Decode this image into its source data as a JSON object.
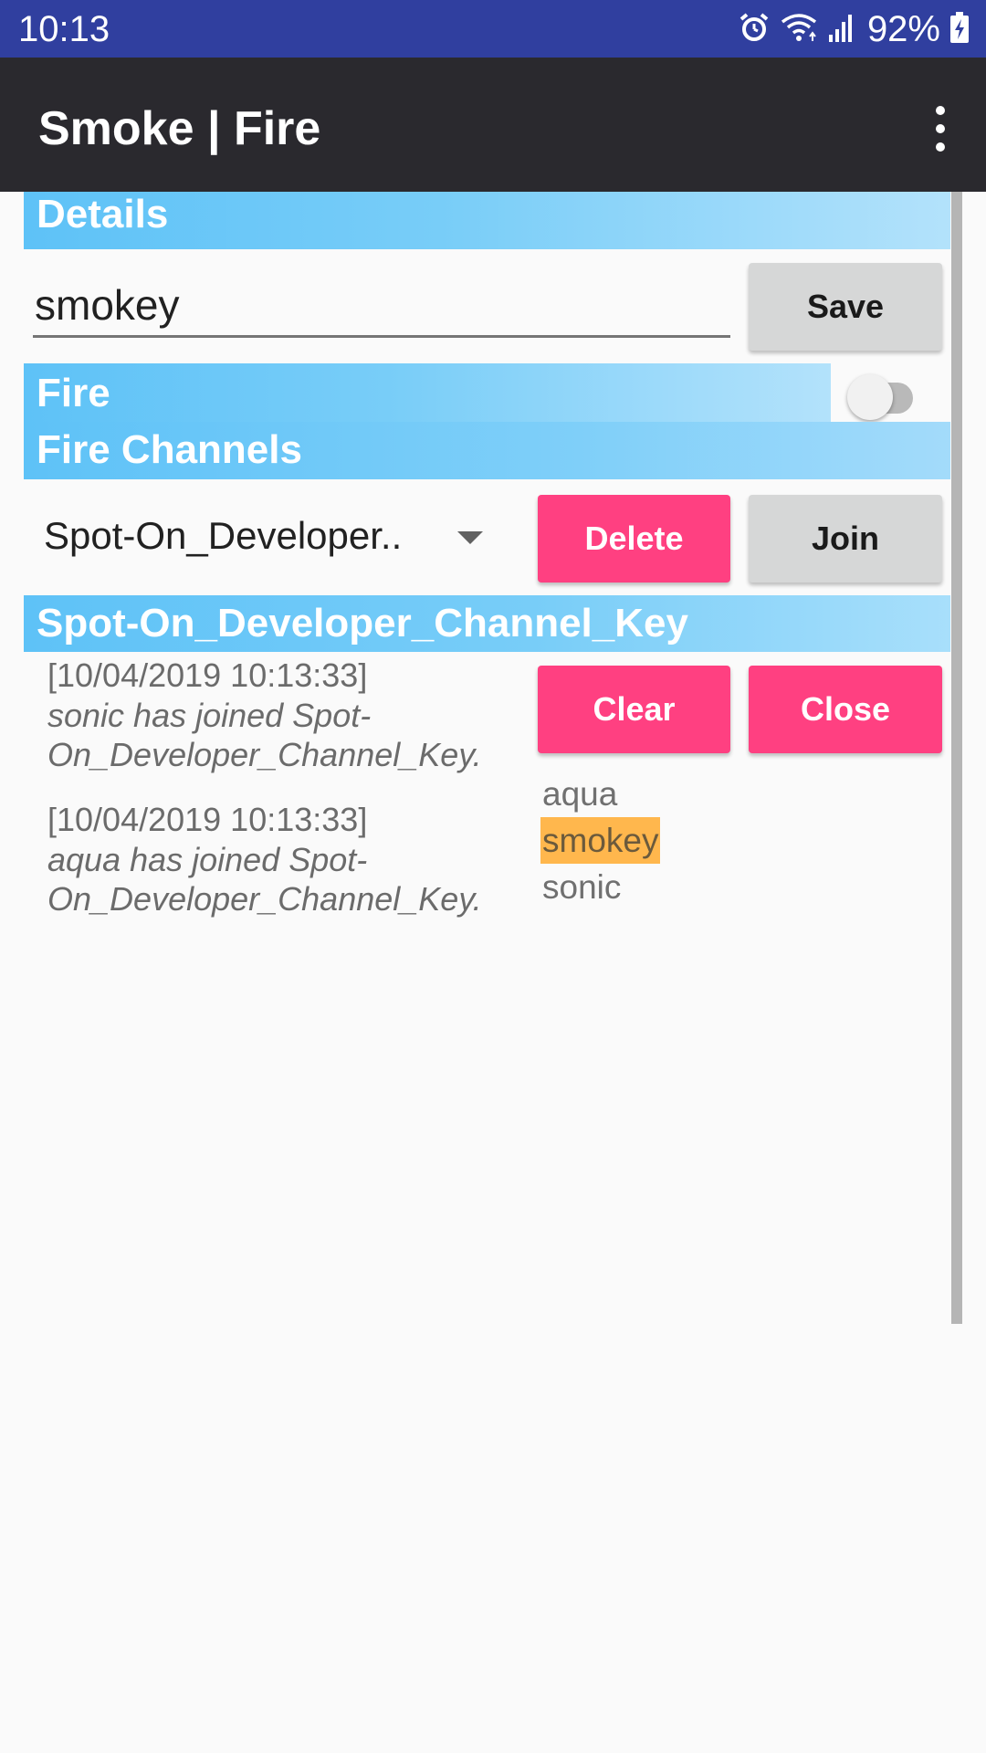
{
  "status_bar": {
    "time": "10:13",
    "battery_percent": "92%",
    "icons": [
      "alarm-icon",
      "wifi-icon",
      "signal-icon",
      "battery-charging-icon"
    ]
  },
  "app_bar": {
    "title": "Smoke | Fire",
    "menu_icon": "more-vert-icon"
  },
  "details": {
    "header": "Details",
    "name_value": "smokey",
    "save_label": "Save"
  },
  "fire": {
    "header": "Fire",
    "toggle_on": false
  },
  "fire_channels": {
    "header": "Fire Channels",
    "selected_channel": "Spot-On_Developer..",
    "delete_label": "Delete",
    "join_label": "Join"
  },
  "channel": {
    "header": "Spot-On_Developer_Channel_Key",
    "clear_label": "Clear",
    "close_label": "Close",
    "messages": [
      {
        "time": "[10/04/2019 10:13:33]",
        "text": "sonic has joined Spot-\nOn_Developer_Channel_Key."
      },
      {
        "time": "[10/04/2019 10:13:33]",
        "text": "aqua has joined Spot-\nOn_Developer_Channel_Key."
      }
    ],
    "members": [
      "aqua",
      "smokey",
      "sonic"
    ]
  },
  "colors": {
    "status_bar": "#303f9f",
    "app_bar": "#2a292e",
    "section_header": "#5ec2f7",
    "accent_button": "#ff4081",
    "neutral_button": "#d6d7d7",
    "self_highlight": "#ffb74d"
  }
}
